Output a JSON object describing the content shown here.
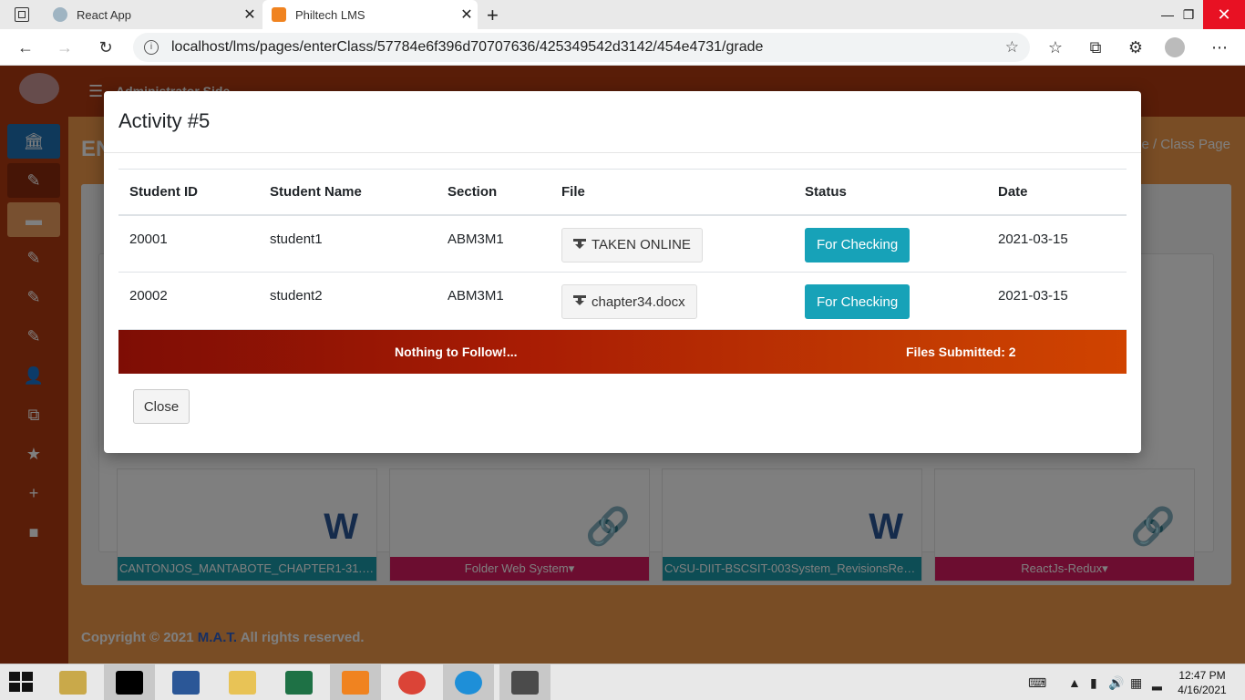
{
  "browser": {
    "tabs": [
      {
        "label": "React App",
        "active": false
      },
      {
        "label": "Philtech LMS",
        "active": true
      }
    ],
    "url": "localhost/lms/pages/enterClass/57784e6f396d70707636/425349542d3142/454e4731/grade"
  },
  "app": {
    "top_title": "Administrator Side",
    "page_heading": "EN",
    "breadcrumb": "e / Class Page",
    "files": [
      {
        "name": "CANTONJOS_MANTABOTE_CHAPTER1-31.docx▾",
        "icon": "word-icon",
        "icon_glyph": "W"
      },
      {
        "name": "Folder Web System▾",
        "icon": "link-icon",
        "icon_glyph": "🔗"
      },
      {
        "name": "CvSU-DIIT-BSCSIT-003System_RevisionsRev_1...",
        "icon": "word-icon",
        "icon_glyph": "W"
      },
      {
        "name": "ReactJs-Redux▾",
        "icon": "link-icon",
        "icon_glyph": "🔗"
      }
    ],
    "footer": {
      "prefix": "Copyright © 2021 ",
      "brand": "M.A.T.",
      "suffix": " All rights reserved."
    }
  },
  "modal": {
    "title": "Activity #5",
    "columns": [
      "Student ID",
      "Student Name",
      "Section",
      "File",
      "Status",
      "Date"
    ],
    "rows": [
      {
        "student_id": "20001",
        "student_name": "student1",
        "section": "ABM3M1",
        "file": "TAKEN ONLINE",
        "status": "For Checking",
        "date": "2021-03-15"
      },
      {
        "student_id": "20002",
        "student_name": "student2",
        "section": "ABM3M1",
        "file": "chapter34.docx",
        "status": "For Checking",
        "date": "2021-03-15"
      }
    ],
    "summary_left": "Nothing to Follow!...",
    "summary_right": "Files Submitted: 2",
    "close_label": "Close"
  },
  "taskbar": {
    "time": "12:47 PM",
    "date": "4/16/2021"
  },
  "colors": {
    "sidebar": "#b33a10",
    "accent_teal": "#17a2b8",
    "summary_gradient_start": "#7e0d05",
    "summary_gradient_end": "#d04300"
  }
}
